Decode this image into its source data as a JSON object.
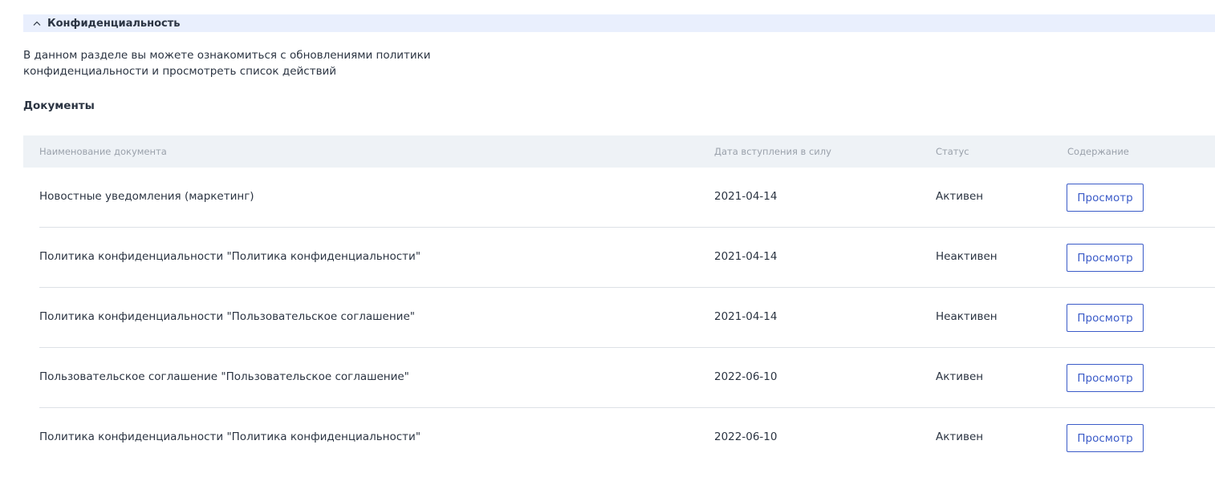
{
  "section": {
    "title": "Конфиденциальность",
    "toggle_icon": "chevron-up-icon",
    "description": "В данном разделе вы можете ознакомиться с обновлениями политики\nконфиденциальности и просмотреть список действий"
  },
  "documents": {
    "title": "Документы",
    "columns": {
      "name": "Наименование документа",
      "date": "Дата вступления в силу",
      "status": "Статус",
      "content": "Содержание"
    },
    "rows": [
      {
        "name": "Новостные уведомления (маркетинг)",
        "date": "2021-04-14",
        "status": "Активен",
        "action": "Просмотр"
      },
      {
        "name": "Политика конфиденциальности \"Политика конфиденциальности\"",
        "date": "2021-04-14",
        "status": "Неактивен",
        "action": "Просмотр"
      },
      {
        "name": "Политика конфиденциальности \"Пользовательское соглашение\"",
        "date": "2021-04-14",
        "status": "Неактивен",
        "action": "Просмотр"
      },
      {
        "name": "Пользовательское соглашение \"Пользовательское соглашение\"",
        "date": "2022-06-10",
        "status": "Активен",
        "action": "Просмотр"
      },
      {
        "name": "Политика конфиденциальности \"Политика конфиденциальности\"",
        "date": "2022-06-10",
        "status": "Активен",
        "action": "Просмотр"
      }
    ]
  },
  "colors": {
    "accent": "#3b5bc8",
    "header_bg": "#e9effd",
    "table_header_bg": "#eef2f6",
    "text": "#2b3442",
    "muted_text": "#9aa1ab",
    "divider": "#dde1e6"
  }
}
